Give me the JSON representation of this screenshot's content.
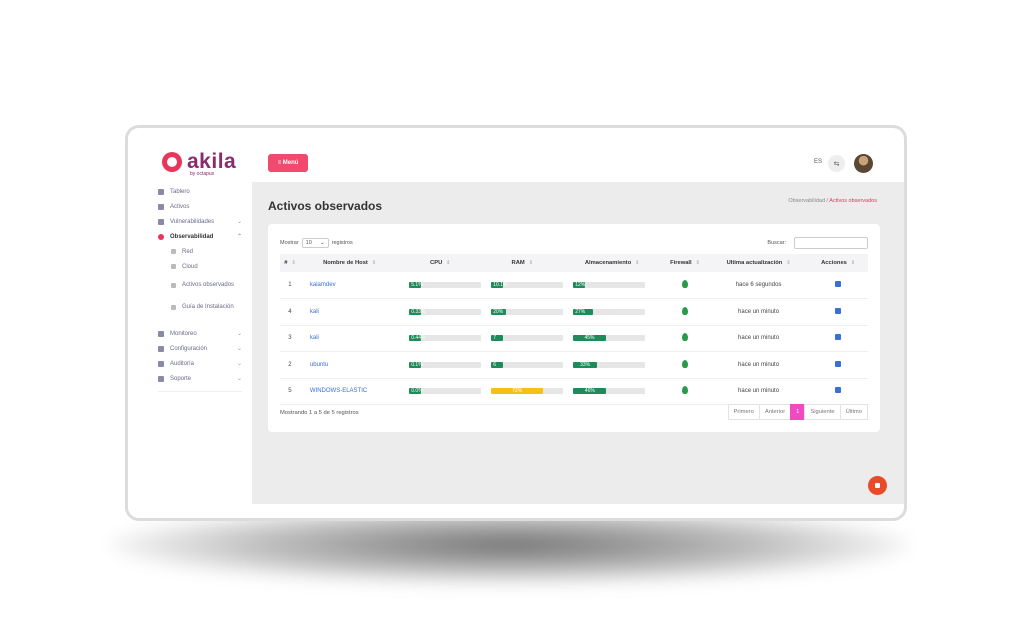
{
  "brand": {
    "name": "akila",
    "sub": "by octapus",
    "accent": "#e8355b"
  },
  "sidebar": {
    "items": [
      {
        "label": "Tablero",
        "icon": "dashboard-icon"
      },
      {
        "label": "Activos",
        "icon": "assets-icon"
      },
      {
        "label": "Vulnerabilidades",
        "icon": "bug-icon",
        "chevron": "⌄"
      },
      {
        "label": "Observabilidad",
        "icon": "search-icon",
        "chevron": "⌃",
        "active": true
      }
    ],
    "sub_items": [
      {
        "label": "Red",
        "icon": "network-icon"
      },
      {
        "label": "Cloud",
        "icon": "cloud-icon"
      },
      {
        "label": "Activos observados",
        "icon": "location-icon"
      },
      {
        "label": "Guía de Instalación",
        "icon": "guide-icon"
      }
    ],
    "bottom_items": [
      {
        "label": "Monitoreo",
        "icon": "monitor-icon",
        "chevron": "⌄"
      },
      {
        "label": "Configuración",
        "icon": "gear-icon",
        "chevron": "⌄"
      },
      {
        "label": "Auditoría",
        "icon": "audit-icon",
        "chevron": "⌄"
      },
      {
        "label": "Soporte",
        "icon": "support-icon",
        "chevron": "⌄"
      }
    ]
  },
  "topbar": {
    "menu_label": "≡ Menú",
    "lang": "ES",
    "translate_icon": "⇆"
  },
  "page": {
    "title": "Activos observados",
    "breadcrumb": {
      "parent": "Observabilidad",
      "sep": "/",
      "current": "Activos observados"
    }
  },
  "table_controls": {
    "show_label": "Mostrar",
    "show_value": "10",
    "show_suffix": "registros",
    "search_label": "Buscar:"
  },
  "table": {
    "columns": [
      "#",
      "Nombre de Host",
      "CPU",
      "RAM",
      "Almacenamiento",
      "Firewall",
      "Ultima actualización",
      "Acciones"
    ],
    "rows": [
      {
        "id": "1",
        "host": "kalamdev",
        "cpu": "5.1%",
        "cpu_pct": 5.1,
        "ram": "10.1%",
        "ram_pct": 10.1,
        "storage": "12%",
        "storage_pct": 12,
        "updated": "hace 6 segundos"
      },
      {
        "id": "4",
        "host": "kali",
        "cpu": "0.33%",
        "cpu_pct": 0.33,
        "ram": "20%",
        "ram_pct": 20,
        "storage": "27%",
        "storage_pct": 27,
        "updated": "hace un minuto"
      },
      {
        "id": "3",
        "host": "kali",
        "cpu": "0.44%",
        "cpu_pct": 0.44,
        "ram": "7",
        "ram_pct": 7,
        "storage": "45%",
        "storage_pct": 45,
        "updated": "hace un minuto"
      },
      {
        "id": "2",
        "host": "ubuntu",
        "cpu": "0.1%",
        "cpu_pct": 0.1,
        "ram": "6",
        "ram_pct": 6,
        "storage": "33%",
        "storage_pct": 33,
        "updated": "hace un minuto"
      },
      {
        "id": "5",
        "host": "WINDOWS-ELASTIC",
        "cpu": "0.0%",
        "cpu_pct": 0.0,
        "ram": "72%",
        "ram_pct": 72,
        "storage": "46%",
        "storage_pct": 46,
        "updated": "hace un minuto"
      }
    ]
  },
  "footer": {
    "info": "Mostrando 1 a 5 de 5 registros",
    "pager": [
      "Primero",
      "Anterior",
      "1",
      "Siguiente",
      "Último"
    ]
  }
}
